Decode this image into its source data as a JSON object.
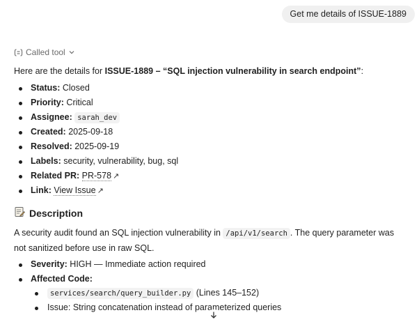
{
  "user_message": "Get me details of ISSUE-1889",
  "tool_call": {
    "label": "Called tool",
    "icon": "tool-call-icon",
    "chevron": "chevron-down-icon"
  },
  "intro": {
    "prefix": "Here are the details for ",
    "issue_id": "ISSUE-1889",
    "separator": " – ",
    "title": "“SQL injection vulnerability in search endpoint”",
    "suffix": ":"
  },
  "details": [
    {
      "key": "Status:",
      "value": "Closed"
    },
    {
      "key": "Priority:",
      "value": "Critical"
    },
    {
      "key": "Assignee:",
      "code": "sarah_dev"
    },
    {
      "key": "Created:",
      "value": "2025-09-18"
    },
    {
      "key": "Resolved:",
      "value": "2025-09-19"
    },
    {
      "key": "Labels:",
      "value": "security, vulnerability, bug, sql"
    },
    {
      "key": "Related PR:",
      "link": "PR-578"
    },
    {
      "key": "Link:",
      "link": "View Issue"
    }
  ],
  "description": {
    "icon": "memo-icon",
    "heading": "Description",
    "para_before": "A security audit found an SQL injection vulnerability in ",
    "para_code": "/api/v1/search",
    "para_after": ". The query parameter was not sanitized before use in raw SQL.",
    "severity_key": "Severity:",
    "severity_value": "HIGH — Immediate action required",
    "affected_key": "Affected Code:",
    "affected_items": [
      {
        "code": "services/search/query_builder.py",
        "text": " (Lines 145–152)"
      },
      {
        "text": "Issue: String concatenation instead of parameterized queries"
      }
    ]
  },
  "scroll_button": {
    "icon": "arrow-down-icon"
  }
}
